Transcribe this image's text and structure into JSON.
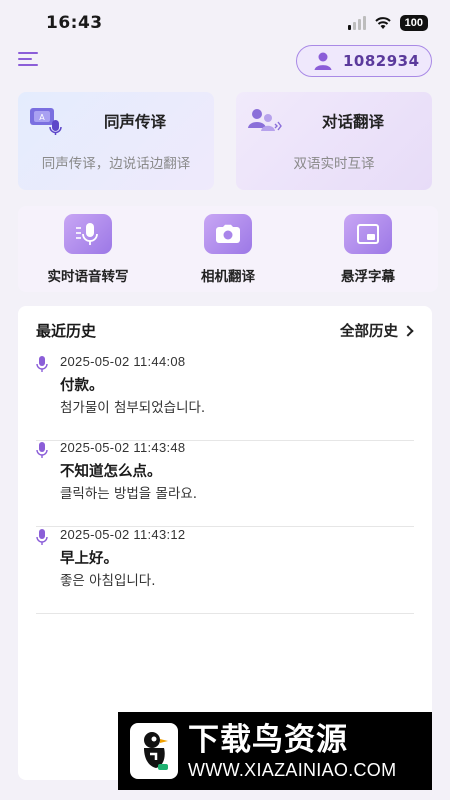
{
  "status": {
    "time": "16:43",
    "battery": "100"
  },
  "user": {
    "id": "1082934"
  },
  "cards": {
    "simultaneous": {
      "title": "同声传译",
      "subtitle": "同声传译，边说话边翻译"
    },
    "dialog": {
      "title": "对话翻译",
      "subtitle": "双语实时互译"
    }
  },
  "tools": [
    {
      "label": "实时语音转写"
    },
    {
      "label": "相机翻译"
    },
    {
      "label": "悬浮字幕"
    }
  ],
  "history": {
    "title": "最近历史",
    "all_label": "全部历史",
    "entries": [
      {
        "time": "2025-05-02 11:44:08",
        "source": "付款。",
        "target": "첨가물이 첨부되었습니다."
      },
      {
        "time": "2025-05-02 11:43:48",
        "source": "不知道怎么点。",
        "target": "클릭하는 방법을 몰라요."
      },
      {
        "time": "2025-05-02 11:43:12",
        "source": "早上好。",
        "target": "좋은 아침입니다."
      }
    ]
  },
  "watermark": {
    "title": "下载鸟资源",
    "url": "WWW.XIAZAINIAO.COM"
  },
  "colors": {
    "accent": "#8b5ed8",
    "card_blue": "#e4ecfd",
    "card_purple": "#e7dcf8"
  }
}
